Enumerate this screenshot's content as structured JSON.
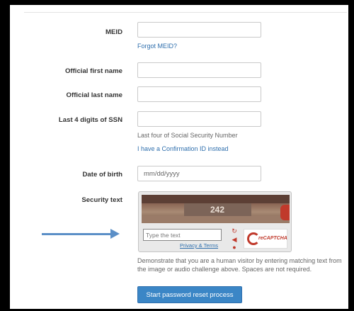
{
  "form": {
    "meid": {
      "label": "MEID",
      "value": "",
      "link": "Forgot MEID?"
    },
    "first_name": {
      "label": "Official first name",
      "value": ""
    },
    "last_name": {
      "label": "Official last name",
      "value": ""
    },
    "ssn": {
      "label": "Last 4 digits of SSN",
      "value": "",
      "help": "Last four of Social Security Number",
      "link": "I have a Confirmation ID instead"
    },
    "dob": {
      "label": "Date of birth",
      "placeholder": "mm/dd/yyyy"
    },
    "security": {
      "label": "Security text",
      "captcha": {
        "image_text": "242",
        "input_placeholder": "Type the text",
        "privacy_terms": "Privacy & Terms",
        "controls": [
          "refresh-icon",
          "audio-icon",
          "help-icon"
        ],
        "brand": "reCAPTCHA"
      },
      "description": "Demonstrate that you are a human visitor by entering matching text from the image or audio challenge above. Spaces are not required."
    },
    "submit_label": "Start password reset process"
  },
  "colors": {
    "link": "#2f6fad",
    "button": "#3b86c6",
    "arrow": "#5b8fc7",
    "captcha_red": "#c0392b"
  }
}
